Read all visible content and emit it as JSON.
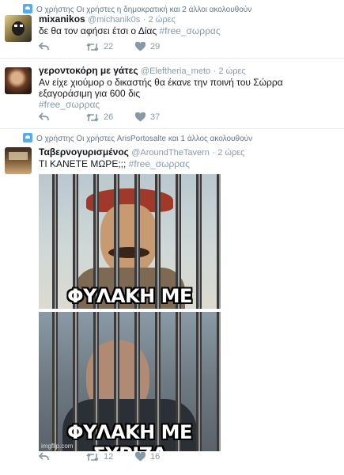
{
  "tweets": [
    {
      "context": "Ο χρήστης Οι χρήστες η δημοκρατική και 2 άλλοι ακολουθούν",
      "name": "mixanikos",
      "handle": "@michanik0s",
      "sep": "·",
      "time": "2 ώρες",
      "text": "δε θα τον αφήσει έτσι ο Δίας",
      "hashtag": "#free_σωρρας",
      "retweets": "22",
      "likes": "29"
    },
    {
      "context": "",
      "name": "γεροντοκόρη με γάτες",
      "handle": "@Eleftheria_meto",
      "sep": "·",
      "time": "2 ώρες",
      "text": "Αν είχε χιούμορ ο δικαστής θα έκανε την ποινή του Σώρρα εξαγοράσιμη για 600 δις",
      "hashtag": "#free_σωρρας",
      "retweets": "26",
      "likes": "37"
    },
    {
      "context": "Ο χρήστης Οι χρήστες ArisPortosalte και 1 άλλος ακολουθούν",
      "name": "Ταβερνογυρισμένος",
      "handle": "@AroundTheTavern",
      "sep": "·",
      "time": "2 ώρες",
      "text": "ΤΙ ΚΑΝΕΤΕ ΜΩΡΕ;;;",
      "hashtag": "#free_σωρρας",
      "media_caption_top": "ΦΥΛΑΚΗ ΜΕ ΟΘΩΝΑ",
      "media_caption_bottom": "ΦΥΛΑΚΗ ΜΕ ΣΥΡΙΖΑ",
      "media_watermark": "imgflip.com",
      "retweets": "12",
      "likes": "16"
    }
  ],
  "icons": {
    "context": "user-follow-icon",
    "reply": "reply-icon",
    "retweet": "retweet-icon",
    "like": "heart-icon"
  },
  "colors": {
    "link_gray": "#8899a6",
    "accent": "#55acee",
    "divider": "#e6ecf0"
  }
}
